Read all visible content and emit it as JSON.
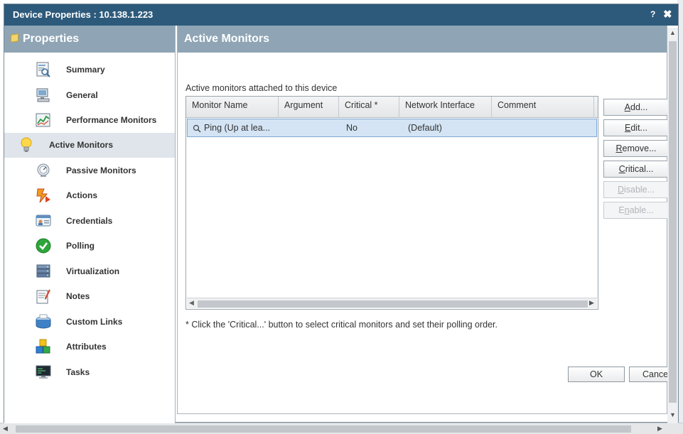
{
  "dialog": {
    "title": "Device Properties : 10.138.1.223",
    "help": "?",
    "close": "✖"
  },
  "nav": {
    "header": "Properties",
    "items": [
      {
        "label": "Summary",
        "icon": "summary-icon"
      },
      {
        "label": "General",
        "icon": "computer-icon"
      },
      {
        "label": "Performance Monitors",
        "icon": "performance-chart-icon"
      },
      {
        "label": "Active Monitors",
        "icon": "lightbulb-icon",
        "active": true
      },
      {
        "label": "Passive Monitors",
        "icon": "passive-monitor-icon"
      },
      {
        "label": "Actions",
        "icon": "actions-icon"
      },
      {
        "label": "Credentials",
        "icon": "credentials-icon"
      },
      {
        "label": "Polling",
        "icon": "polling-check-icon"
      },
      {
        "label": "Virtualization",
        "icon": "virtualization-icon"
      },
      {
        "label": "Notes",
        "icon": "notes-icon"
      },
      {
        "label": "Custom Links",
        "icon": "custom-links-icon"
      },
      {
        "label": "Attributes",
        "icon": "attributes-icon"
      },
      {
        "label": "Tasks",
        "icon": "tasks-icon"
      }
    ]
  },
  "main": {
    "header": "Active Monitors",
    "caption": "Active monitors attached to this device",
    "columns": [
      "Monitor Name",
      "Argument",
      "Critical *",
      "Network Interface",
      "Comment"
    ],
    "rows": [
      {
        "monitor_name": "Ping (Up at lea...",
        "argument": "",
        "critical": "No",
        "network_interface": "(Default)",
        "comment": ""
      }
    ],
    "buttons": {
      "add": {
        "label": "Add...",
        "u": "A",
        "rest": "dd..."
      },
      "edit": {
        "label": "Edit...",
        "u": "E",
        "rest": "dit..."
      },
      "remove": {
        "label": "Remove...",
        "u": "R",
        "rest": "emove..."
      },
      "critical": {
        "label": "Critical...",
        "u": "C",
        "rest": "ritical..."
      },
      "disable": {
        "label": "Disable...",
        "u": "D",
        "rest": "isable..."
      },
      "enable": {
        "label": "Enable...",
        "pre": "E",
        "u": "n",
        "rest": "able..."
      }
    },
    "footnote": "* Click the 'Critical...' button to select critical monitors and set their polling order.",
    "ok": "OK",
    "cancel": "Cance"
  },
  "colors": {
    "titlebar": "#2d5a7b",
    "header": "#8fa5b5",
    "selected_row": "#d4e4f4",
    "active_nav": "#dfe5ea"
  }
}
